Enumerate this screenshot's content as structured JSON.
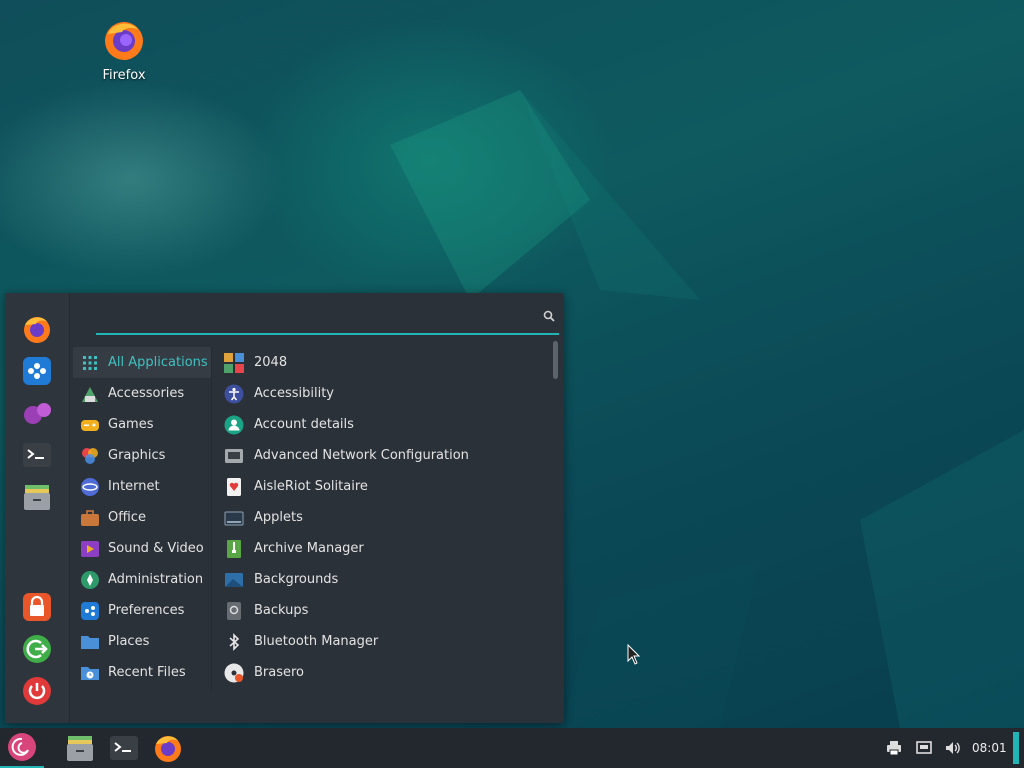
{
  "desktop": {
    "icons": [
      {
        "label": "Firefox",
        "icon": "firefox-icon"
      }
    ]
  },
  "menu": {
    "search": {
      "value": "",
      "placeholder": ""
    },
    "favorites": [
      {
        "name": "firefox",
        "icon": "firefox-icon"
      },
      {
        "name": "software-manager",
        "icon": "software-icon"
      },
      {
        "name": "chat",
        "icon": "chat-icon"
      },
      {
        "name": "terminal",
        "icon": "terminal-icon"
      },
      {
        "name": "file-manager",
        "icon": "files-icon"
      }
    ],
    "session": [
      {
        "name": "lock-screen",
        "icon": "lock-icon"
      },
      {
        "name": "logout",
        "icon": "logout-icon"
      },
      {
        "name": "shutdown",
        "icon": "power-icon"
      }
    ],
    "categories": [
      {
        "label": "All Applications",
        "icon": "grid-icon",
        "active": true
      },
      {
        "label": "Accessories",
        "icon": "accessories-icon"
      },
      {
        "label": "Games",
        "icon": "gamepad-icon"
      },
      {
        "label": "Graphics",
        "icon": "graphics-icon"
      },
      {
        "label": "Internet",
        "icon": "globe-icon"
      },
      {
        "label": "Office",
        "icon": "briefcase-icon"
      },
      {
        "label": "Sound & Video",
        "icon": "media-icon"
      },
      {
        "label": "Administration",
        "icon": "admin-icon"
      },
      {
        "label": "Preferences",
        "icon": "preferences-icon"
      },
      {
        "label": "Places",
        "icon": "folder-icon"
      },
      {
        "label": "Recent Files",
        "icon": "recent-files-icon"
      }
    ],
    "applications": [
      {
        "label": "2048",
        "icon": "2048-icon"
      },
      {
        "label": "Accessibility",
        "icon": "accessibility-icon"
      },
      {
        "label": "Account details",
        "icon": "user-icon"
      },
      {
        "label": "Advanced Network Configuration",
        "icon": "network-icon"
      },
      {
        "label": "AisleRiot Solitaire",
        "icon": "cards-icon"
      },
      {
        "label": "Applets",
        "icon": "applets-icon"
      },
      {
        "label": "Archive Manager",
        "icon": "archive-icon"
      },
      {
        "label": "Backgrounds",
        "icon": "backgrounds-icon"
      },
      {
        "label": "Backups",
        "icon": "backups-icon"
      },
      {
        "label": "Bluetooth Manager",
        "icon": "bluetooth-icon"
      },
      {
        "label": "Brasero",
        "icon": "disc-icon"
      }
    ]
  },
  "taskbar": {
    "launchers": [
      "files-icon",
      "terminal-icon",
      "firefox-icon"
    ],
    "tray": [
      "printer-icon",
      "network-icon",
      "volume-icon"
    ],
    "clock": "08:01"
  },
  "colors": {
    "accent": "#23b5b5",
    "menu_bg": "#2b3138",
    "taskbar_bg": "#23282e"
  }
}
